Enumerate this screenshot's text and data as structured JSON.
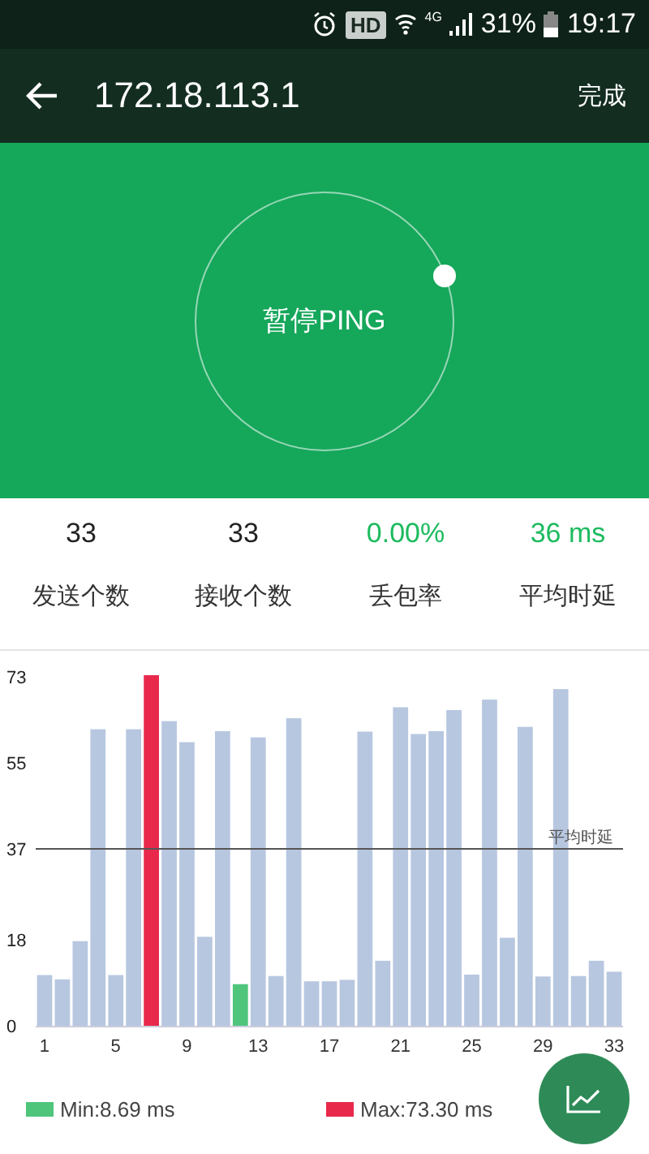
{
  "status_bar": {
    "badge": "HD",
    "network": "4G",
    "battery": "31%",
    "time": "19:17"
  },
  "app_bar": {
    "title": "172.18.113.1",
    "action": "完成"
  },
  "dial": {
    "label": "暂停PING"
  },
  "stats": [
    {
      "value": "33",
      "label": "发送个数",
      "kind": "plain"
    },
    {
      "value": "33",
      "label": "接收个数",
      "kind": "plain"
    },
    {
      "value": "0.00%",
      "label": "丢包率",
      "kind": "good"
    },
    {
      "value": "36 ms",
      "label": "平均时延",
      "kind": "good"
    }
  ],
  "chart": {
    "chart_data": {
      "type": "bar",
      "stacked": true,
      "x": [
        1,
        2,
        3,
        4,
        5,
        6,
        7,
        8,
        9,
        10,
        11,
        12,
        13,
        14,
        15,
        16,
        17,
        18,
        19,
        20,
        21,
        22,
        23,
        24,
        25,
        26,
        27,
        28,
        29,
        30,
        31,
        32,
        33
      ],
      "series": [
        {
          "color": "#b7c7e0",
          "values": [
            10.6,
            9.7,
            17.7,
            62,
            10.6,
            62,
            null,
            63.7,
            59.3,
            18.6,
            61.6,
            null,
            60.3,
            10.4,
            64.3,
            9.3,
            9.3,
            9.6,
            61.5,
            13.6,
            66.6,
            61,
            61.6,
            66,
            10.7,
            68.2,
            18.4,
            62.5,
            10.3,
            70.4,
            10.4,
            13.6,
            11.3
          ]
        },
        {
          "color": "#4fc57c",
          "values": [
            null,
            null,
            null,
            null,
            null,
            null,
            null,
            null,
            null,
            null,
            null,
            8.7,
            null,
            null,
            null,
            null,
            null,
            null,
            null,
            null,
            null,
            null,
            null,
            null,
            null,
            null,
            null,
            null,
            null,
            null,
            null,
            null,
            null
          ]
        },
        {
          "color": "#e8294b",
          "values": [
            null,
            null,
            null,
            null,
            null,
            null,
            73.3,
            null,
            null,
            null,
            null,
            null,
            null,
            null,
            null,
            null,
            null,
            null,
            null,
            null,
            null,
            null,
            null,
            null,
            null,
            null,
            null,
            null,
            null,
            null,
            null,
            null,
            null
          ]
        }
      ],
      "xlim": [
        0.5,
        33.5
      ],
      "ylim": [
        0,
        73.3
      ],
      "yticks": [
        0,
        18,
        37,
        55,
        73
      ],
      "xticks": [
        1,
        5,
        9,
        13,
        17,
        21,
        25,
        29,
        33
      ],
      "ref_lines": [
        {
          "axis": "y",
          "value": 37,
          "label": "平均时延"
        }
      ]
    }
  },
  "legend": [
    {
      "label": "Min:8.69 ms",
      "color": "#4fc57c"
    },
    {
      "label": "Max:73.30 ms",
      "color": "#e8294b"
    }
  ]
}
